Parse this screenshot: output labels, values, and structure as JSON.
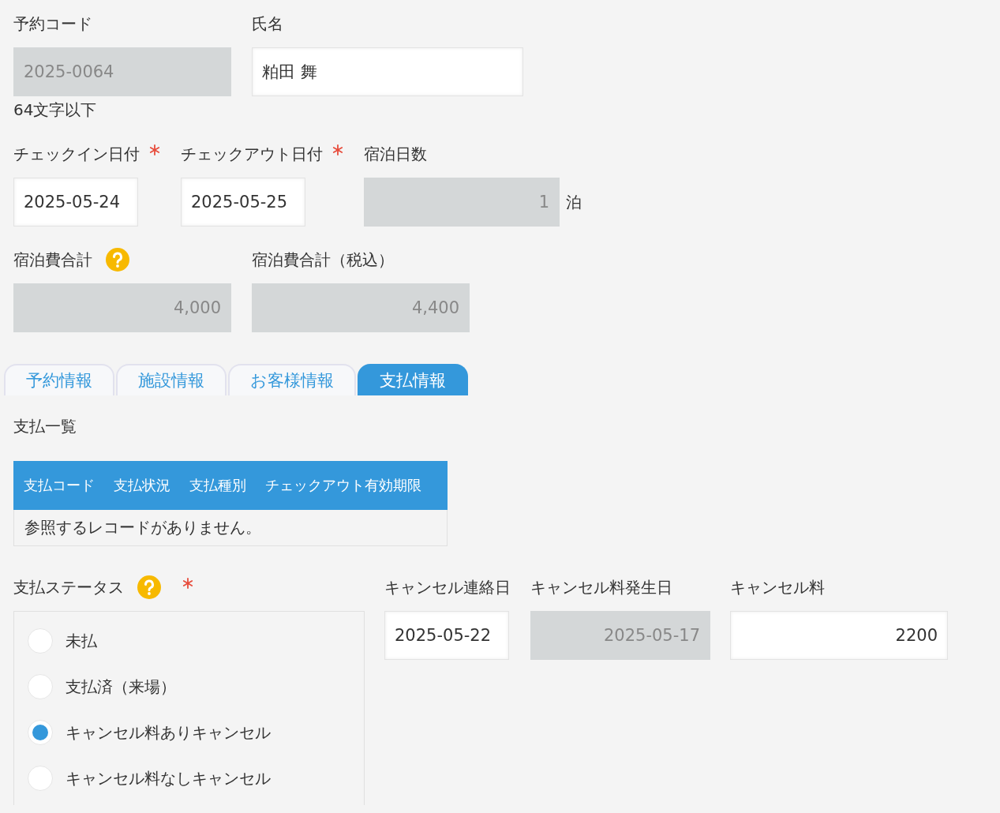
{
  "rows": [
    {
      "fields": [
        {
          "label": "予約コード",
          "kind": "text",
          "readonly": true,
          "value": "2025-0064",
          "hint": "64文字以下"
        },
        {
          "label": "氏名",
          "kind": "text",
          "readonly": false,
          "value": "粕田 舞"
        }
      ]
    },
    {
      "fields": [
        {
          "label": "チェックイン日付",
          "kind": "date",
          "readonly": false,
          "required": true,
          "value": "2025-05-24"
        },
        {
          "label": "チェックアウト日付",
          "kind": "date",
          "readonly": false,
          "required": true,
          "value": "2025-05-25"
        },
        {
          "label": "宿泊日数",
          "kind": "number",
          "readonly": true,
          "value": "1",
          "suffix": "泊"
        }
      ]
    },
    {
      "fields": [
        {
          "label": "宿泊費合計",
          "kind": "number",
          "readonly": true,
          "help": true,
          "value": "4,000"
        },
        {
          "label": "宿泊費合計（税込）",
          "kind": "number",
          "readonly": true,
          "value": "4,400"
        }
      ]
    }
  ],
  "tabs": [
    {
      "label": "予約情報",
      "selected": false
    },
    {
      "label": "施設情報",
      "selected": false
    },
    {
      "label": "お客様情報",
      "selected": false
    },
    {
      "label": "支払情報",
      "selected": true
    }
  ],
  "payment_list": {
    "label": "支払一覧",
    "columns": [
      "支払コード",
      "支払状況",
      "支払種別",
      "チェックアウト有効期限"
    ],
    "empty_message": "参照するレコードがありません。"
  },
  "payment_status": {
    "label": "支払ステータス",
    "help": true,
    "required": true,
    "options": [
      {
        "label": "未払",
        "selected": false
      },
      {
        "label": "支払済（来場）",
        "selected": false
      },
      {
        "label": "キャンセル料ありキャンセル",
        "selected": true
      },
      {
        "label": "キャンセル料なしキャンセル",
        "selected": false
      }
    ]
  },
  "cancel_fields": [
    {
      "label": "キャンセル連絡日",
      "kind": "date",
      "readonly": false,
      "value": "2025-05-22"
    },
    {
      "label": "キャンセル料発生日",
      "kind": "calculated",
      "readonly": true,
      "value": "2025-05-17"
    },
    {
      "label": "キャンセル料",
      "kind": "number",
      "readonly": false,
      "value": "2200"
    }
  ]
}
